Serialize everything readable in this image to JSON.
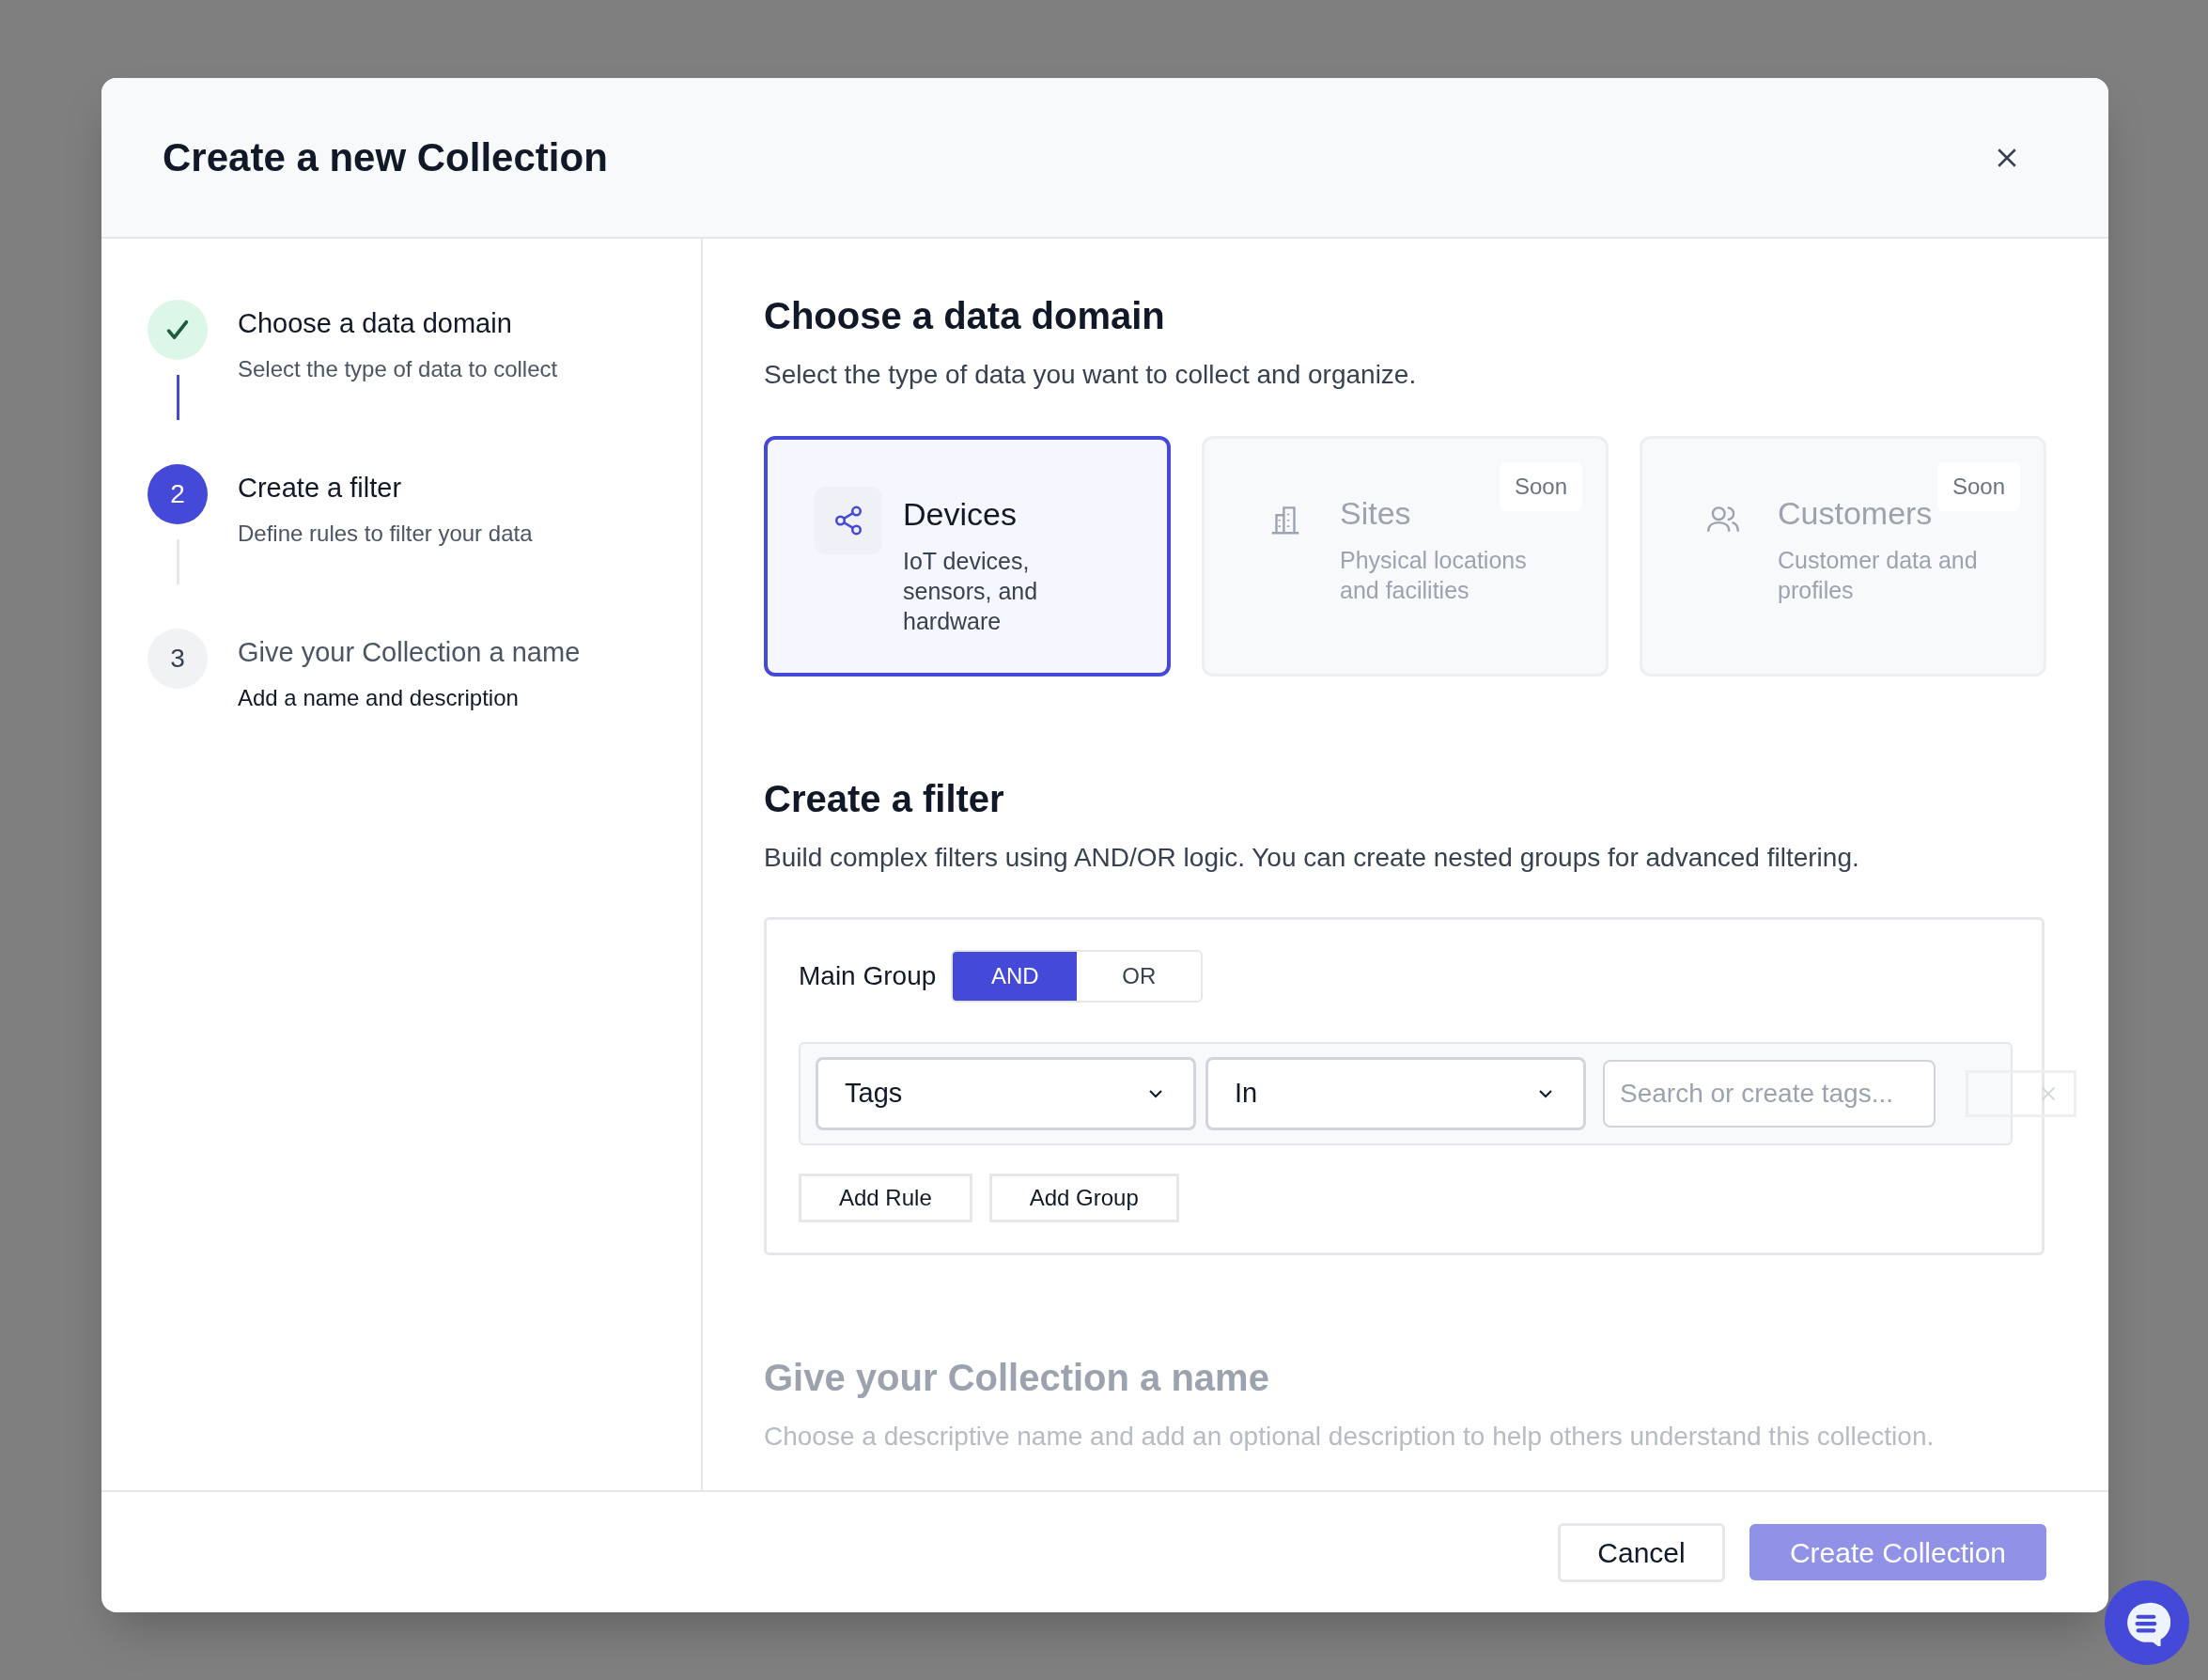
{
  "modal": {
    "title": "Create a new Collection"
  },
  "steps": [
    {
      "completed": true,
      "selected": false,
      "title": "Choose a data domain",
      "description": "Select the type of data to collect"
    },
    {
      "completed": false,
      "selected": true,
      "number": "2",
      "title": "Create a filter",
      "description": "Define rules to filter your data"
    },
    {
      "completed": false,
      "selected": false,
      "number": "3",
      "title": "Give your Collection a name",
      "description": "Add a name and description"
    }
  ],
  "domain_section": {
    "title": "Choose a data domain",
    "subtitle": "Select the type of data you want to collect and organize.",
    "cards": [
      {
        "kind": "devices",
        "title": "Devices",
        "description": "IoT devices, sensors, and hardware",
        "selected": true,
        "disabled": false
      },
      {
        "kind": "sites",
        "title": "Sites",
        "description": "Physical locations and facilities",
        "badge": "Soon",
        "selected": false,
        "disabled": true
      },
      {
        "kind": "customers",
        "title": "Customers",
        "description": "Customer data and profiles",
        "badge": "Soon",
        "selected": false,
        "disabled": true
      }
    ]
  },
  "filter_section": {
    "title": "Create a filter",
    "subtitle": "Build complex filters using AND/OR logic. You can create nested groups for advanced filtering.",
    "group_label": "Main Group",
    "logic": [
      {
        "label": "AND",
        "selected": true
      },
      {
        "label": "OR",
        "selected": false
      }
    ],
    "rule": {
      "field": "Tags",
      "operator": "In",
      "value_placeholder": "Search or create tags..."
    },
    "buttons": [
      "Add Rule",
      "Add Group"
    ]
  },
  "name_section": {
    "title": "Give your Collection a name",
    "subtitle": "Choose a descriptive name and add an optional description to help others understand this collection.",
    "disabled": true
  },
  "footer": {
    "cancel": "Cancel",
    "submit": "Create Collection",
    "submit_disabled": true
  }
}
